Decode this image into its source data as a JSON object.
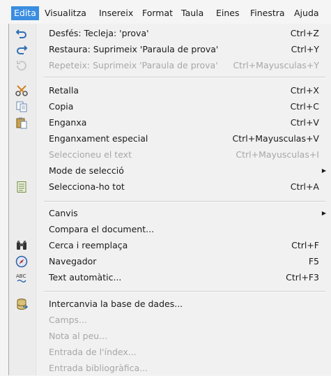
{
  "menubar": {
    "items": [
      {
        "label": "Edita"
      },
      {
        "label": "Visualitza"
      },
      {
        "label": "Insereix"
      },
      {
        "label": "Format"
      },
      {
        "label": "Taula"
      },
      {
        "label": "Eines"
      },
      {
        "label": "Finestra"
      },
      {
        "label": "Ajuda"
      }
    ]
  },
  "edit_menu": {
    "items": [
      {
        "label": "Desfés: Tecleja: 'prova'",
        "shortcut": "Ctrl+Z",
        "icon": "undo-icon",
        "enabled": true
      },
      {
        "label": "Restaura: Suprimeix 'Paraula de prova'",
        "shortcut": "Ctrl+Y",
        "icon": "redo-icon",
        "enabled": true
      },
      {
        "label": "Repeteix: Suprimeix 'Paraula de prova'",
        "shortcut": "Ctrl+Mayusculas+Y",
        "icon": "repeat-icon",
        "enabled": false
      },
      {
        "label": "Retalla",
        "shortcut": "Ctrl+X",
        "icon": "scissors-icon",
        "enabled": true
      },
      {
        "label": "Copia",
        "shortcut": "Ctrl+C",
        "icon": "copy-icon",
        "enabled": true
      },
      {
        "label": "Enganxa",
        "shortcut": "Ctrl+V",
        "icon": "paste-icon",
        "enabled": true
      },
      {
        "label": "Enganxament especial",
        "shortcut": "Ctrl+Mayusculas+V",
        "enabled": true
      },
      {
        "label": "Seleccioneu el text",
        "shortcut": "Ctrl+Mayusculas+I",
        "enabled": false
      },
      {
        "label": "Mode de selecció",
        "shortcut": "",
        "enabled": true
      },
      {
        "label": "Selecciona-ho tot",
        "shortcut": "Ctrl+A",
        "icon": "select-all-icon",
        "enabled": true
      },
      {
        "label": "Canvis",
        "shortcut": "",
        "enabled": true
      },
      {
        "label": "Compara el document...",
        "shortcut": "",
        "enabled": true
      },
      {
        "label": "Cerca i reemplaça",
        "shortcut": "Ctrl+F",
        "icon": "binoculars-icon",
        "enabled": true
      },
      {
        "label": "Navegador",
        "shortcut": "F5",
        "icon": "compass-icon",
        "enabled": true
      },
      {
        "label": "Text automàtic...",
        "shortcut": "Ctrl+F3",
        "icon": "autotext-icon",
        "enabled": true
      },
      {
        "label": "Intercanvia la base de dades...",
        "shortcut": "",
        "icon": "database-icon",
        "enabled": true
      },
      {
        "label": "Camps...",
        "shortcut": "",
        "enabled": false
      },
      {
        "label": "Nota al peu...",
        "shortcut": "",
        "enabled": false
      },
      {
        "label": "Entrada de l'índex...",
        "shortcut": "",
        "enabled": false
      },
      {
        "label": "Entrada bibliogràfica...",
        "shortcut": "",
        "enabled": false
      }
    ],
    "autotext_icon_text": "ABC"
  },
  "colors": {
    "active_menu_bg": "#3a8de0",
    "disabled_text": "#a7a7a7",
    "highlight_bg": "#dbe6f4"
  }
}
